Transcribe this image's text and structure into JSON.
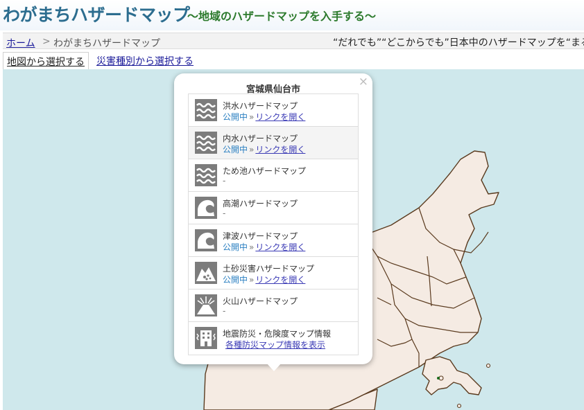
{
  "header": {
    "title": "わがまちハザードマップ",
    "subtitle": "～地域のハザードマップを入手する～"
  },
  "breadcrumb": {
    "home": "ホーム",
    "separator": ">",
    "current": "わがまちハザードマップ"
  },
  "marquee": "“だれでも”“どこからでも”日本中のハザードマップを“まる",
  "tabs": [
    {
      "label": "地図から選択する",
      "active": true
    },
    {
      "label": "災害種別から選択する",
      "active": false
    }
  ],
  "popup": {
    "close": "×",
    "title": "宮城県仙台市",
    "items": [
      {
        "name": "洪水ハザードマップ",
        "status": "公開中",
        "arrow": "»",
        "link": "リンクを開く",
        "icon": "flood-icon"
      },
      {
        "name": "内水ハザードマップ",
        "status": "公開中",
        "arrow": "»",
        "link": "リンクを開く",
        "icon": "inland-water-icon"
      },
      {
        "name": "ため池ハザードマップ",
        "status": "-",
        "icon": "reservoir-icon"
      },
      {
        "name": "高潮ハザードマップ",
        "status": "-",
        "icon": "storm-surge-icon"
      },
      {
        "name": "津波ハザードマップ",
        "status": "公開中",
        "arrow": "»",
        "link": "リンクを開く",
        "icon": "tsunami-icon"
      },
      {
        "name": "土砂災害ハザードマップ",
        "status": "公開中",
        "arrow": "»",
        "link": "リンクを開く",
        "icon": "landslide-icon"
      },
      {
        "name": "火山ハザードマップ",
        "status": "-",
        "icon": "volcano-icon"
      },
      {
        "name": "地震防災・危険度マップ情報",
        "link": "各種防災マップ情報を表示",
        "icon": "earthquake-building-icon"
      }
    ]
  },
  "colors": {
    "title": "#2c6d8f",
    "subtitle": "#2c7a2c",
    "sea": "#cfe8ec",
    "land": "#f5ebe3",
    "border": "#5a3a1e",
    "status": "#2a7fc1",
    "link": "#3a3ab5"
  }
}
